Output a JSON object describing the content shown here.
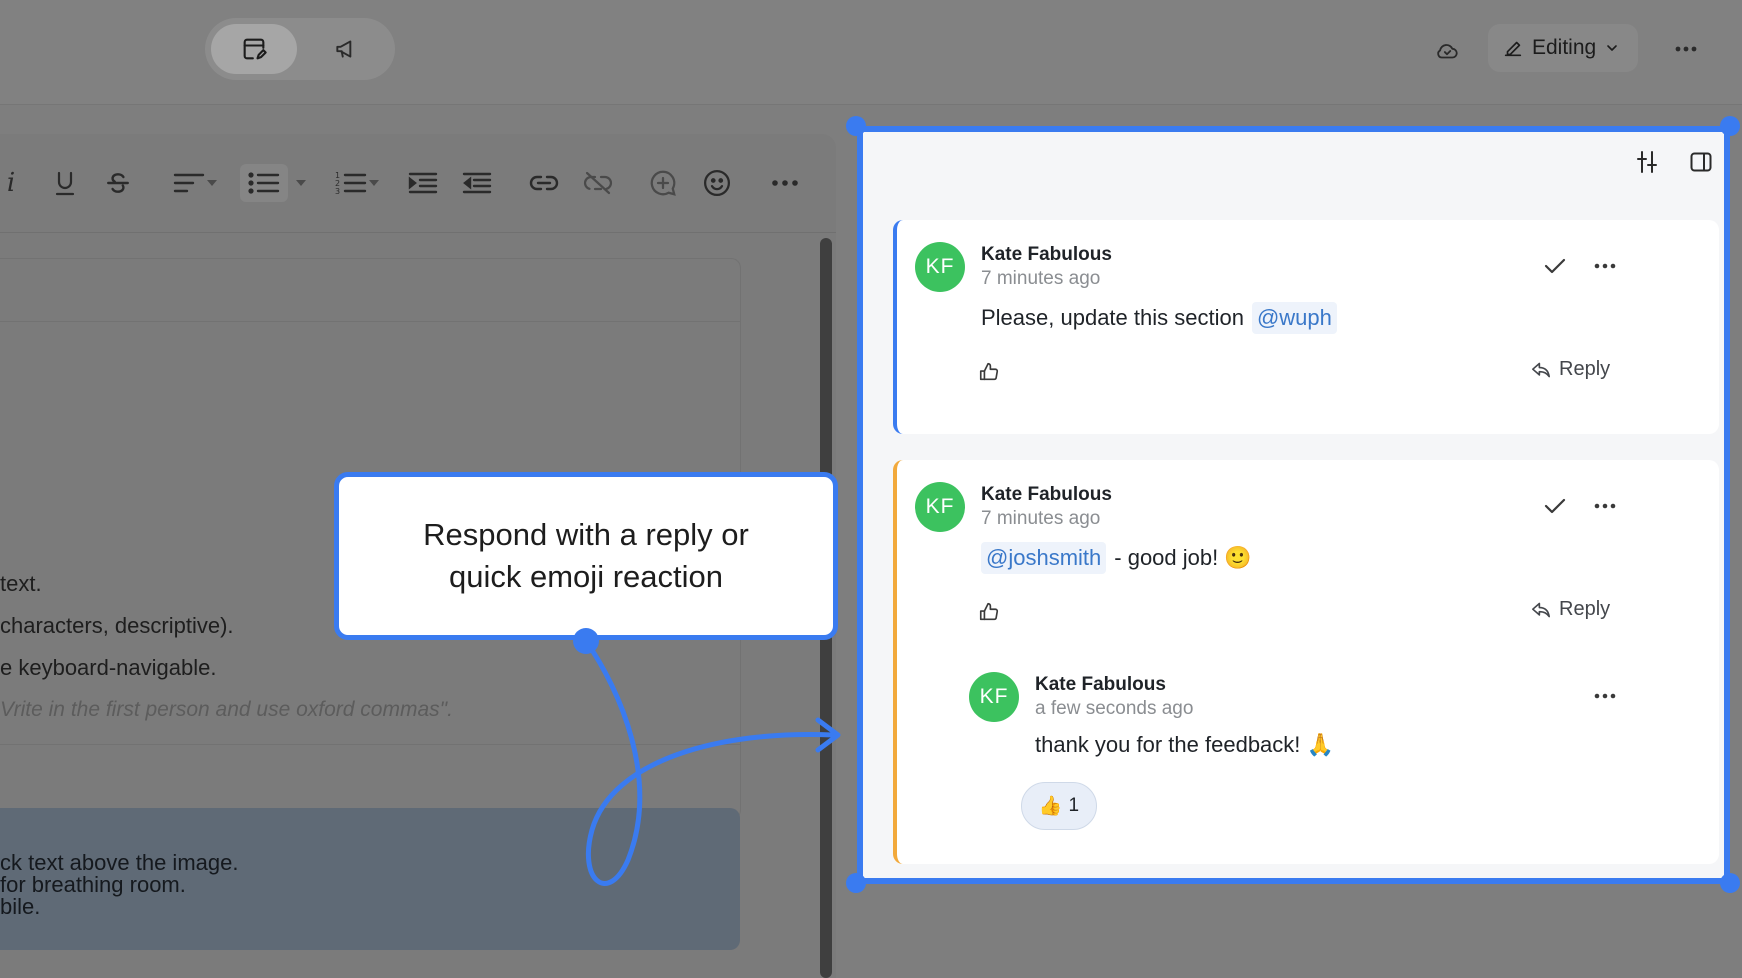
{
  "toolbar_top": {
    "mode_label": "Editing"
  },
  "editor": {
    "lines": [
      "text.",
      "characters, descriptive).",
      "e keyboard-navigable."
    ],
    "italic_hint": "Vrite in the first person and use oxford commas\".",
    "blue_lines": [
      "ck text above the image.",
      "for breathing room.",
      "bile."
    ]
  },
  "callout": {
    "line1": "Respond with a reply or",
    "line2": "quick emoji reaction"
  },
  "threads": [
    {
      "accent": "#3a7bf0",
      "author": "Kate Fabulous",
      "initials": "KF",
      "time": "7 minutes ago",
      "text": "Please, update this section",
      "mention": "@wuph",
      "reply_label": "Reply"
    },
    {
      "accent": "#f2a93b",
      "author": "Kate Fabulous",
      "initials": "KF",
      "time": "7 minutes ago",
      "mention": "@joshsmith",
      "text": "- good job! 🙂",
      "reply_label": "Reply",
      "reply": {
        "author": "Kate Fabulous",
        "initials": "KF",
        "time": "a few seconds ago",
        "text": "thank you for the feedback! 🙏",
        "reaction_emoji": "👍",
        "reaction_count": "1"
      }
    }
  ],
  "colors": {
    "accent_blue": "#3a7bf0",
    "avatar_green": "#3cc25f",
    "thread_orange": "#f2a93b",
    "mention_blue": "#3a78c9"
  }
}
